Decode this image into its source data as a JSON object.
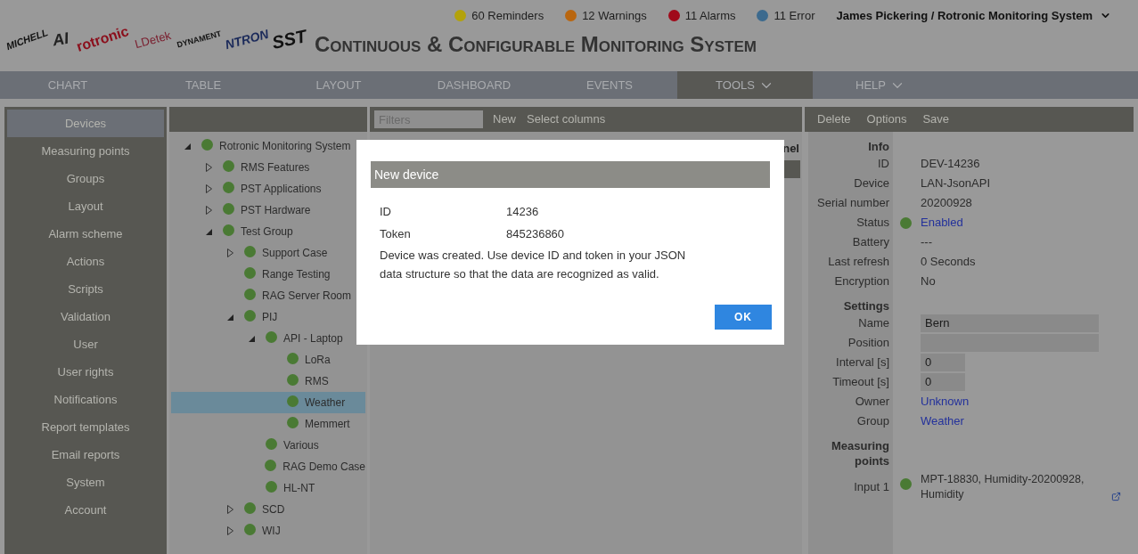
{
  "logos": [
    {
      "text": "MICHELL"
    },
    {
      "text": "AI"
    },
    {
      "text": "rotronic"
    },
    {
      "text": "LDetek"
    },
    {
      "text": "DYNAMENT"
    },
    {
      "text": "NTRON"
    },
    {
      "text": "SST"
    }
  ],
  "title": "Continuous & Configurable Monitoring System",
  "status": [
    {
      "label": "60 Reminders",
      "color": "#b3a20b"
    },
    {
      "label": "12 Warnings",
      "color": "#b9660f"
    },
    {
      "label": "11 Alarms",
      "color": "#a00a1a"
    },
    {
      "label": "11 Error",
      "color": "#3c6a8e"
    }
  ],
  "user": "James Pickering / Rotronic Monitoring System",
  "nav": [
    {
      "label": "CHART",
      "selected": false,
      "menu": false
    },
    {
      "label": "TABLE",
      "selected": false,
      "menu": false
    },
    {
      "label": "LAYOUT",
      "selected": false,
      "menu": false
    },
    {
      "label": "DASHBOARD",
      "selected": false,
      "menu": false
    },
    {
      "label": "EVENTS",
      "selected": false,
      "menu": false
    },
    {
      "label": "TOOLS",
      "selected": true,
      "menu": true
    },
    {
      "label": "HELP",
      "selected": false,
      "menu": true
    }
  ],
  "sidebar": {
    "items": [
      {
        "label": "Devices",
        "selected": true
      },
      {
        "label": "Measuring points",
        "selected": false
      },
      {
        "label": "Groups",
        "selected": false
      },
      {
        "label": "Layout",
        "selected": false
      },
      {
        "label": "Alarm scheme",
        "selected": false
      },
      {
        "label": "Actions",
        "selected": false
      },
      {
        "label": "Scripts",
        "selected": false
      },
      {
        "label": "Validation",
        "selected": false
      },
      {
        "label": "User",
        "selected": false
      },
      {
        "label": "User rights",
        "selected": false
      },
      {
        "label": "Notifications",
        "selected": false
      },
      {
        "label": "Report templates",
        "selected": false
      },
      {
        "label": "Email reports",
        "selected": false
      },
      {
        "label": "System",
        "selected": false
      },
      {
        "label": "Account",
        "selected": false
      }
    ]
  },
  "tree": [
    {
      "label": "Rotronic Monitoring System",
      "expanded": true,
      "selected": false,
      "children": [
        {
          "label": "RMS Features",
          "expanded": false,
          "selected": false
        },
        {
          "label": "PST Applications",
          "expanded": false,
          "selected": false
        },
        {
          "label": "PST Hardware",
          "expanded": false,
          "selected": false
        },
        {
          "label": "Test Group",
          "expanded": true,
          "selected": false,
          "children": [
            {
              "label": "Support Case",
              "expanded": false,
              "selected": false
            },
            {
              "label": "Range Testing",
              "selected": false
            },
            {
              "label": "RAG Server Room",
              "selected": false
            },
            {
              "label": "PIJ",
              "expanded": true,
              "selected": false,
              "children": [
                {
                  "label": "API - Laptop",
                  "expanded": true,
                  "selected": false,
                  "children": [
                    {
                      "label": "LoRa",
                      "selected": false
                    },
                    {
                      "label": "RMS",
                      "selected": false
                    },
                    {
                      "label": "Weather",
                      "selected": true
                    },
                    {
                      "label": "Memmert",
                      "selected": false
                    }
                  ]
                },
                {
                  "label": "Various",
                  "selected": false
                },
                {
                  "label": "RAG Demo Case",
                  "selected": false
                },
                {
                  "label": "HL-NT",
                  "selected": false
                }
              ]
            },
            {
              "label": "SCD",
              "expanded": false,
              "selected": false
            },
            {
              "label": "WIJ",
              "expanded": false,
              "selected": false
            }
          ]
        }
      ]
    }
  ],
  "list_toolbar": {
    "filter_placeholder": "Filters",
    "actions": [
      "New",
      "Select columns"
    ]
  },
  "list": {
    "column_visible": "nel"
  },
  "detail_toolbar": [
    "Delete",
    "Options",
    "Save"
  ],
  "detail": [
    {
      "kind": "heading",
      "label": "Info"
    },
    {
      "kind": "text",
      "label": "ID",
      "value": "DEV-14236"
    },
    {
      "kind": "text",
      "label": "Device",
      "value": "LAN-JsonAPI"
    },
    {
      "kind": "text",
      "label": "Serial number",
      "value": "20200928"
    },
    {
      "kind": "status",
      "label": "Status",
      "value": "Enabled",
      "color": "#4a7a34"
    },
    {
      "kind": "text",
      "label": "Battery",
      "value": "---"
    },
    {
      "kind": "text",
      "label": "Last refresh",
      "value": "0 Seconds"
    },
    {
      "kind": "text",
      "label": "Encryption",
      "value": "No"
    },
    {
      "kind": "heading",
      "label": "Settings"
    },
    {
      "kind": "input",
      "label": "Name",
      "value": "Bern"
    },
    {
      "kind": "input",
      "label": "Position"
    },
    {
      "kind": "short-input",
      "label": "Interval [s]",
      "value": "0"
    },
    {
      "kind": "short-input",
      "label": "Timeout [s]",
      "value": "0"
    },
    {
      "kind": "link",
      "label": "Owner",
      "value": "Unknown"
    },
    {
      "kind": "link",
      "label": "Group",
      "value": "Weather"
    },
    {
      "kind": "heading",
      "label": "Measuring points"
    },
    {
      "kind": "point",
      "label": "Input 1",
      "value": "MPT-18830, Humidity-20200928, Humidity",
      "color": "#4a7a34"
    }
  ],
  "dialog": {
    "title": "New device",
    "fields": [
      {
        "label": "ID",
        "value": "14236"
      },
      {
        "label": "Token",
        "value": "845236860"
      }
    ],
    "message": "Device was created. Use device ID and token in your JSON data structure so that the data are recognized as valid.",
    "button": "OK"
  }
}
